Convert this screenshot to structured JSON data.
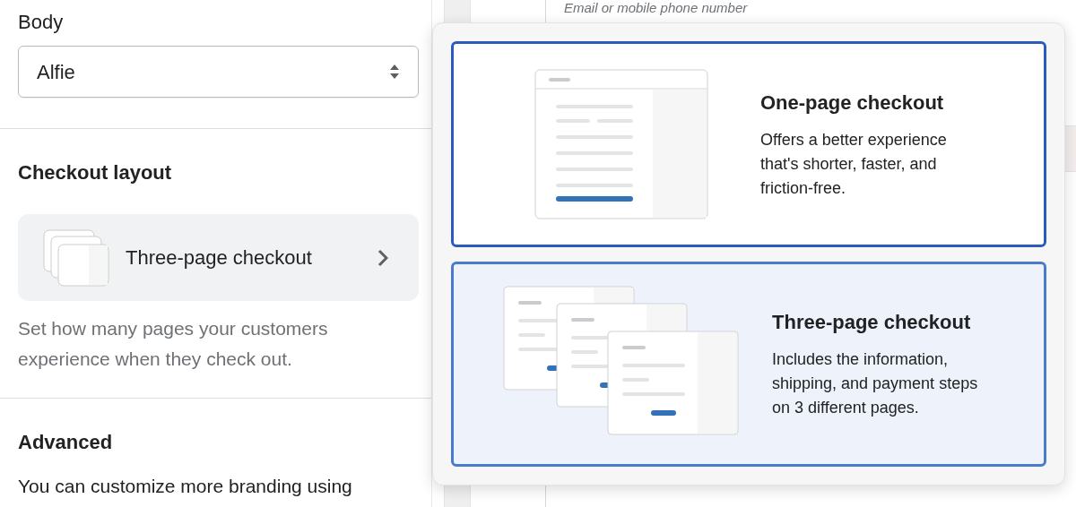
{
  "background_page": {
    "field_label": "Email or mobile phone number"
  },
  "sidebar": {
    "font_label": "Body",
    "font_select": {
      "value": "Alfie"
    },
    "checkout_layout": {
      "title": "Checkout layout",
      "current": "Three-page checkout",
      "description": "Set how many pages your customers experience when they check out."
    },
    "advanced": {
      "title": "Advanced",
      "text": "You can customize more branding using"
    }
  },
  "popover": {
    "options": [
      {
        "kind": "one-page",
        "title": "One-page checkout",
        "description": "Offers a better experience that's shorter, faster, and friction-free.",
        "selected": false,
        "focused": true
      },
      {
        "kind": "three-page",
        "title": "Three-page checkout",
        "description": "Includes the information, shipping, and payment steps on 3 different pages.",
        "selected": true,
        "focused": false
      }
    ]
  }
}
